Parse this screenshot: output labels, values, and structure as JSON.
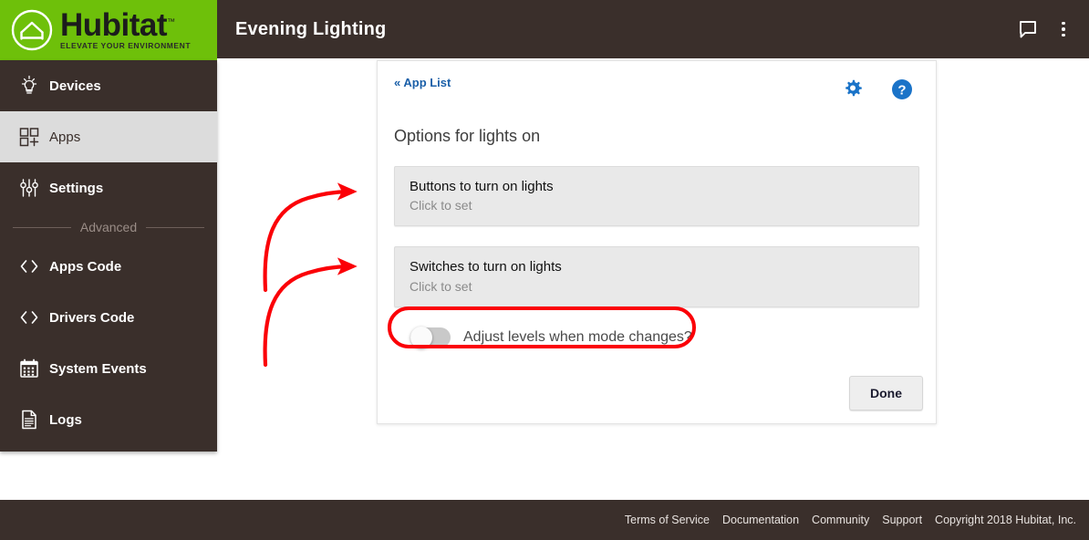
{
  "brand": {
    "name": "Hubitat",
    "trademark": "™",
    "tagline": "ELEVATE YOUR ENVIRONMENT",
    "logo_icon": "house-in-circle-icon",
    "green": "#6ec00a",
    "dark": "#3a2f2b"
  },
  "topbar": {
    "title": "Evening Lighting",
    "chat_icon": "speech-bubble-icon",
    "menu_icon": "kebab-menu-icon"
  },
  "sidebar": {
    "items": [
      {
        "label": "Devices",
        "icon": "lightbulb-icon",
        "active": false
      },
      {
        "label": "Apps",
        "icon": "apps-grid-plus-icon",
        "active": true
      },
      {
        "label": "Settings",
        "icon": "sliders-icon",
        "active": false
      }
    ],
    "separator_label": "Advanced",
    "advanced_items": [
      {
        "label": "Apps Code",
        "icon": "code-brackets-icon",
        "active": false
      },
      {
        "label": "Drivers Code",
        "icon": "code-brackets-icon",
        "active": false
      },
      {
        "label": "System Events",
        "icon": "calendar-icon",
        "active": false
      },
      {
        "label": "Logs",
        "icon": "document-lines-icon",
        "active": false
      }
    ]
  },
  "card": {
    "back_link": "« App List",
    "gear_icon": "gear-icon",
    "help_icon": "help-circle-icon",
    "accent_blue": "#1a73c8",
    "heading": "Options for lights on",
    "fields": [
      {
        "title": "Buttons to turn on lights",
        "hint": "Click to set"
      },
      {
        "title": "Switches to turn on lights",
        "hint": "Click to set"
      }
    ],
    "toggle": {
      "label": "Adjust levels when mode changes?",
      "state": "off"
    },
    "done_label": "Done"
  },
  "footer": {
    "links": [
      "Terms of Service",
      "Documentation",
      "Community",
      "Support"
    ],
    "copyright": "Copyright 2018 Hubitat, Inc."
  },
  "annotations": {
    "color": "#fb0007",
    "shapes": [
      "curved-arrow-to-buttons-field",
      "curved-arrow-to-switches-field",
      "ellipse-around-toggle-row"
    ]
  }
}
